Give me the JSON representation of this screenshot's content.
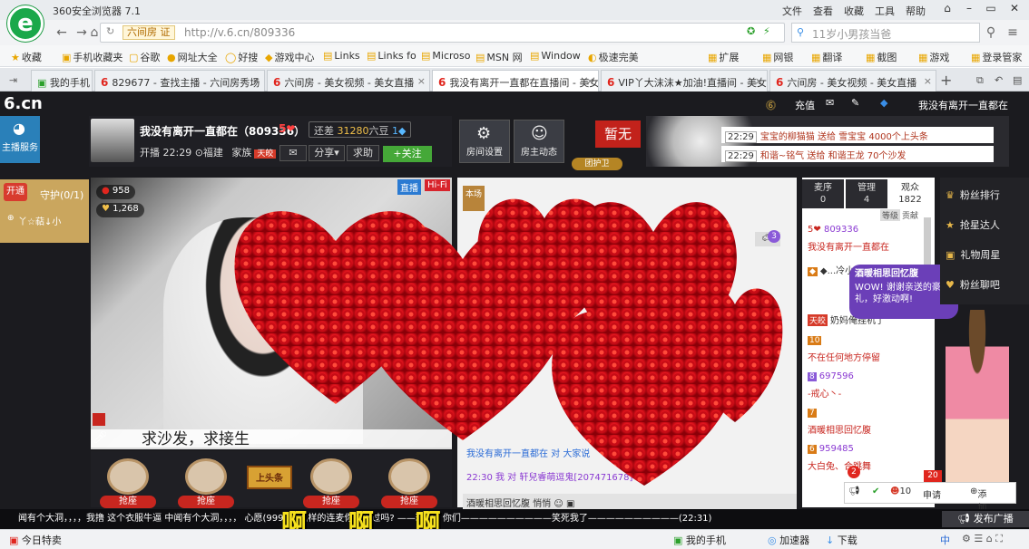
{
  "browser": {
    "app_name": "360安全浏览器 7.1",
    "menus": [
      "文件",
      "查看",
      "收藏",
      "工具",
      "帮助"
    ],
    "address_tag": "六间房 证",
    "url": "http://v.6.cn/809336",
    "search_placeholder": "11岁小男孩当爸",
    "bookmarks": [
      "收藏",
      "手机收藏夹",
      "谷歌",
      "网址大全",
      "好搜",
      "游戏中心",
      "Links",
      "Links fo",
      "Microso",
      "MSN 网",
      "Window",
      "极速完美"
    ],
    "toolbar_right": [
      "扩展",
      "网银",
      "翻译",
      "截图",
      "游戏",
      "登录管家"
    ],
    "tabs": [
      {
        "label": "我的手机",
        "active": false
      },
      {
        "label": "829677 - 查找主播 - 六间房秀场",
        "active": false
      },
      {
        "label": "六间房 - 美女视频 - 美女直播",
        "active": false
      },
      {
        "label": "我没有离开一直都在直播间 - 美女",
        "active": true
      },
      {
        "label": "VIP丫大沫沫★加油!直播间 - 美女",
        "active": false
      },
      {
        "label": "六间房 - 美女视频 - 美女直播",
        "active": false
      }
    ]
  },
  "site": {
    "logo": "6.cn",
    "anchor_service": "主播服务",
    "top_right": {
      "charge": "充值",
      "username": "我没有离开一直都在"
    },
    "host": {
      "name": "我没有离开一直都在（809336）",
      "rank": "5",
      "diff_label": "还差",
      "diff_value": "31280",
      "diff_unit": "六豆",
      "diff_level": "1",
      "start_time": "开播 22:29",
      "location": "福建",
      "family": "家族",
      "family_tag": "天皎",
      "share": "分享",
      "help": "求助",
      "follow": "+关注"
    },
    "room_buttons": [
      "房间设置",
      "房主动态"
    ],
    "zanwu": "暂无",
    "guard_label": "团护卫",
    "banner_msgs": [
      {
        "time": "22:29",
        "text": "宝宝的柳猫猫 送给 雪宝宝 4000个上头条"
      },
      {
        "time": "22:29",
        "text": "和谐~铭气 送给 和谐王龙 70个沙发"
      }
    ],
    "guard": {
      "tab": "开通",
      "label": "守护(0/1)",
      "user": "丫☆萜↓小"
    },
    "video": {
      "badge_live": "直播",
      "badge_hifi": "Hi-Fi",
      "wealth": "958",
      "fans": "1,268",
      "caption": "求沙发，求接生"
    },
    "seats": {
      "btn": "抢座",
      "headline": "上头条"
    },
    "center": {
      "changchang": "本场",
      "chat_lines": [
        {
          "text": "我没有离开一直都在 对 大家说"
        },
        {
          "text": "22:30  我 对 轩兒睿萌逗鬼[207471678]"
        }
      ],
      "chat_bar": "酒暖相思回忆腹   悄悄",
      "count": "3"
    },
    "userlist": {
      "tabs": [
        {
          "label": "麦序",
          "count": "0"
        },
        {
          "label": "管理",
          "count": "4"
        },
        {
          "label": "观众",
          "count": "1822"
        }
      ],
      "header": [
        "等级",
        "贡献"
      ],
      "rows": [
        {
          "lvl": "5",
          "text": "809336"
        },
        {
          "lvl": "",
          "text": "我没有离开一直都在"
        },
        {
          "lvl": "",
          "text": "◆...冷小"
        },
        {
          "lvl": "",
          "text": "奶妈俺挂机了"
        },
        {
          "lvl": "10",
          "text": "不在任何地方停留"
        },
        {
          "lvl": "8",
          "text": "697596"
        },
        {
          "lvl": "",
          "text": "-戒心丶-"
        },
        {
          "lvl": "7",
          "text": "酒暖相思回忆腹"
        },
        {
          "lvl": "6",
          "text": "959485"
        },
        {
          "lvl": "",
          "text": "大白兔、合跳舞"
        }
      ]
    },
    "bubble": {
      "title": "酒暖相思回忆腹",
      "text": "WOW! 谢谢亲送的豪礼，好激动啊!"
    },
    "rank_menu": [
      "粉丝排行",
      "抢星达人",
      "礼物周星",
      "粉丝聊吧"
    ],
    "input": {
      "badge": "2",
      "count": "10",
      "placeholder": "申请",
      "badge20": "20",
      "add": "添加"
    },
    "marquee": "闻有个大洞，，，，我撸 这个衣服牛逼 中闻有个大洞，，，，     心愿(9999): 这样的连麦你们见过吗? ——玩大了你们——————————笑死我了——————————(22:31)",
    "aaa": "啊 啊 啊",
    "broadcast": "发布广播"
  },
  "status": {
    "left": "今日特卖",
    "items": [
      "我的手机",
      "加速器",
      "下载",
      "中"
    ]
  }
}
